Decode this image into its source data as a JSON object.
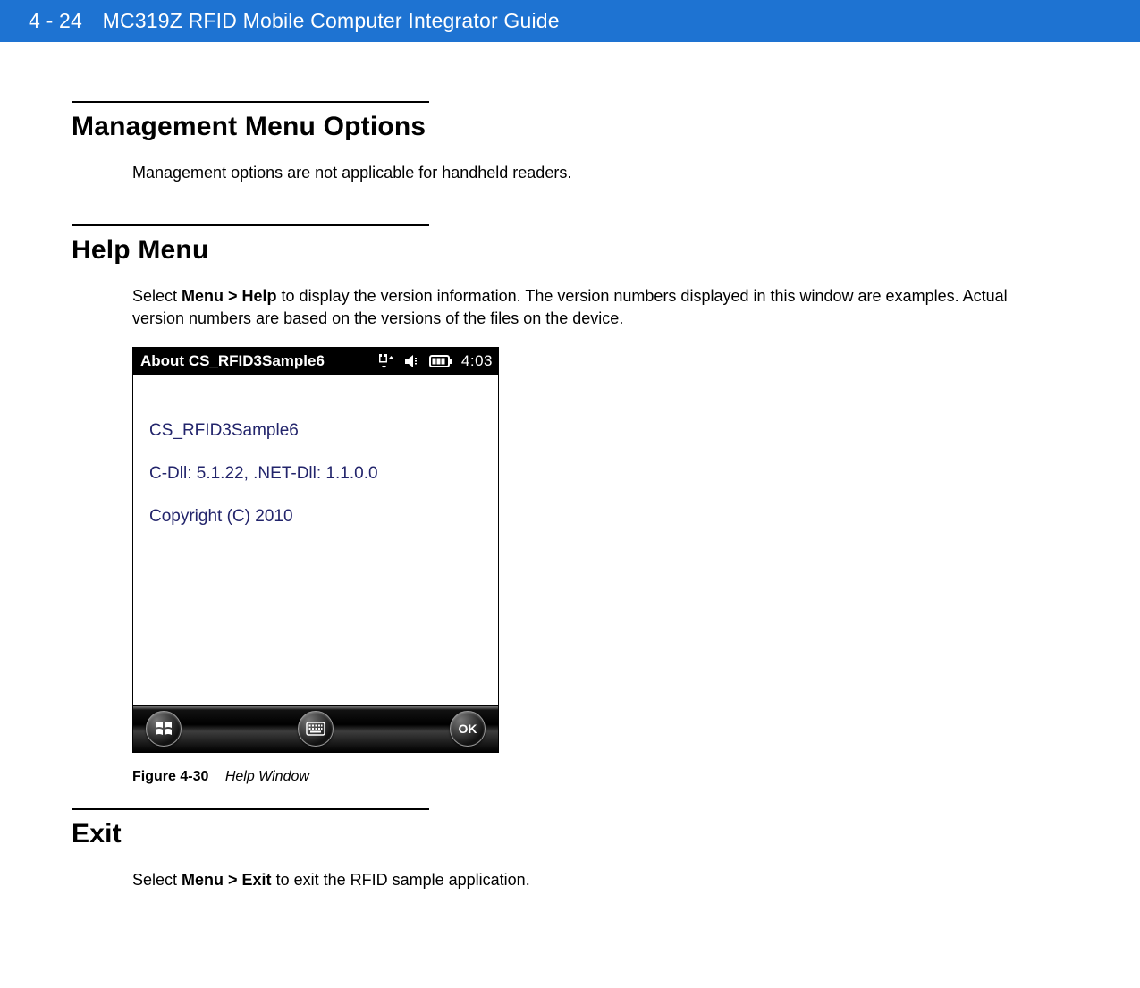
{
  "header": {
    "page_number": "4 - 24",
    "doc_title": "MC319Z RFID Mobile Computer Integrator Guide"
  },
  "sections": {
    "mgmt": {
      "heading": "Management Menu Options",
      "body": "Management options are not applicable for handheld readers."
    },
    "help": {
      "heading": "Help Menu",
      "body_prefix": "Select ",
      "body_bold": "Menu > Help",
      "body_suffix": " to display the version information. The version numbers displayed in this window are examples. Actual version numbers are based on the versions of the files on the device."
    },
    "exit": {
      "heading": "Exit",
      "body_prefix": "Select ",
      "body_bold": "Menu > Exit",
      "body_suffix": " to exit the RFID sample application."
    }
  },
  "device": {
    "title": "About CS_RFID3Sample6",
    "clock": "4:03",
    "lines": {
      "app_name": "CS_RFID3Sample6",
      "versions": "C-Dll: 5.1.22, .NET-Dll: 1.1.0.0",
      "copyright": "Copyright (C) 2010"
    },
    "ok_label": "OK"
  },
  "figure": {
    "label": "Figure 4-30",
    "title": "Help Window"
  }
}
